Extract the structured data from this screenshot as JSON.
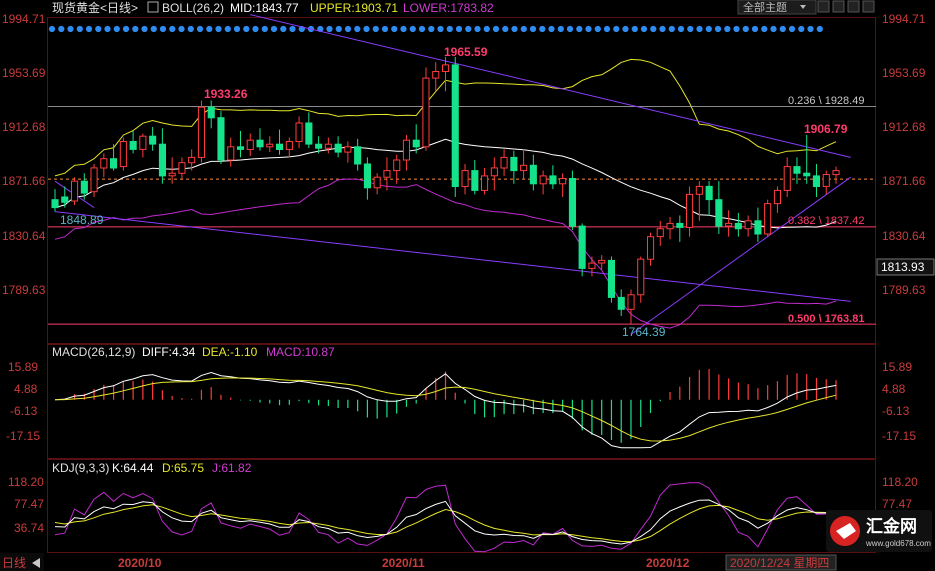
{
  "header": {
    "instrument": "现货黄金<日线>",
    "boll_label": "BOLL(26,2)",
    "mid_label": "MID:1843.77",
    "upper_label": "UPPER:1903.71",
    "lower_label": "LOWER:1783.82",
    "theme_button": "全部主题",
    "theme_icon": "chevron-down-icon",
    "toolbar_icons": [
      "minus-icon",
      "plus-icon",
      "grid-icon",
      "close-icon"
    ]
  },
  "price_panel": {
    "y_ticks": [
      "1994.71",
      "1953.69",
      "1912.68",
      "1871.66",
      "1830.64",
      "1789.63"
    ],
    "last_price": "1813.93",
    "annotations": {
      "high": "1965.59",
      "high2": "1933.26",
      "low": "1764.39",
      "start": "1848.89",
      "recent_high": "1906.79"
    },
    "fib_levels": [
      {
        "label": "0.236 \\ 1928.49",
        "value": 1928.49
      },
      {
        "label": "0.382 \\ 1837.42",
        "value": 1837.42
      },
      {
        "label": "0.500 \\ 1763.81",
        "value": 1763.81
      }
    ],
    "dashed_level": 1873.5
  },
  "macd_panel": {
    "title": "MACD(26,12,9)",
    "diff": "DIFF:4.34",
    "dea": "DEA:-1.10",
    "macd": "MACD:10.87",
    "y_ticks": [
      "15.89",
      "4.88",
      "-6.13",
      "-17.15"
    ]
  },
  "kdj_panel": {
    "title": "KDJ(9,3,3)",
    "k": "K:64.44",
    "d": "D:65.75",
    "j": "J:61.82",
    "y_ticks": [
      "118.20",
      "77.47",
      "36.74"
    ]
  },
  "x_axis": {
    "left_label": "日线",
    "ticks": [
      "2020/10",
      "2020/11",
      "2020/12"
    ],
    "cursor_date": "2020/12/24 星期四"
  },
  "watermark": {
    "brand": "汇金网",
    "url": "www.gold678.com"
  },
  "colors": {
    "up": "#ff3c3c",
    "down": "#14e38c",
    "upper_band": "#e6e62a",
    "mid_band": "#ffffff",
    "lower_band": "#c02ad0",
    "trendline": "#8a3cff",
    "fib_line": "#ff3c6e",
    "axis_text": "#c83c3c",
    "dea": "#e6e62a",
    "diff": "#ffffff",
    "kdj_k": "#ffffff",
    "kdj_d": "#e6e62a",
    "kdj_j": "#c02ad0"
  },
  "chart_data": {
    "type": "candlestick",
    "instrument": "现货黄金",
    "period": "日线",
    "y_range": [
      1750,
      2000
    ],
    "candles": [
      {
        "o": 1858,
        "h": 1866,
        "l": 1849,
        "c": 1852
      },
      {
        "o": 1860,
        "h": 1868,
        "l": 1852,
        "c": 1856
      },
      {
        "o": 1857,
        "h": 1875,
        "l": 1854,
        "c": 1872
      },
      {
        "o": 1872,
        "h": 1878,
        "l": 1858,
        "c": 1863
      },
      {
        "o": 1864,
        "h": 1885,
        "l": 1860,
        "c": 1882
      },
      {
        "o": 1882,
        "h": 1893,
        "l": 1875,
        "c": 1889
      },
      {
        "o": 1889,
        "h": 1900,
        "l": 1880,
        "c": 1882
      },
      {
        "o": 1883,
        "h": 1905,
        "l": 1880,
        "c": 1902
      },
      {
        "o": 1902,
        "h": 1910,
        "l": 1893,
        "c": 1896
      },
      {
        "o": 1896,
        "h": 1908,
        "l": 1890,
        "c": 1906
      },
      {
        "o": 1906,
        "h": 1913,
        "l": 1895,
        "c": 1900
      },
      {
        "o": 1900,
        "h": 1912,
        "l": 1870,
        "c": 1876
      },
      {
        "o": 1876,
        "h": 1890,
        "l": 1870,
        "c": 1878
      },
      {
        "o": 1878,
        "h": 1890,
        "l": 1873,
        "c": 1886
      },
      {
        "o": 1886,
        "h": 1896,
        "l": 1880,
        "c": 1890
      },
      {
        "o": 1890,
        "h": 1933,
        "l": 1886,
        "c": 1928
      },
      {
        "o": 1928,
        "h": 1933,
        "l": 1912,
        "c": 1920
      },
      {
        "o": 1920,
        "h": 1925,
        "l": 1885,
        "c": 1888
      },
      {
        "o": 1888,
        "h": 1905,
        "l": 1883,
        "c": 1898
      },
      {
        "o": 1898,
        "h": 1910,
        "l": 1890,
        "c": 1896
      },
      {
        "o": 1896,
        "h": 1908,
        "l": 1891,
        "c": 1903
      },
      {
        "o": 1903,
        "h": 1912,
        "l": 1895,
        "c": 1898
      },
      {
        "o": 1898,
        "h": 1906,
        "l": 1894,
        "c": 1900
      },
      {
        "o": 1900,
        "h": 1911,
        "l": 1892,
        "c": 1896
      },
      {
        "o": 1896,
        "h": 1905,
        "l": 1890,
        "c": 1902
      },
      {
        "o": 1902,
        "h": 1921,
        "l": 1897,
        "c": 1916
      },
      {
        "o": 1916,
        "h": 1924,
        "l": 1897,
        "c": 1900
      },
      {
        "o": 1900,
        "h": 1906,
        "l": 1893,
        "c": 1897
      },
      {
        "o": 1897,
        "h": 1905,
        "l": 1893,
        "c": 1900
      },
      {
        "o": 1900,
        "h": 1906,
        "l": 1890,
        "c": 1894
      },
      {
        "o": 1894,
        "h": 1902,
        "l": 1886,
        "c": 1898
      },
      {
        "o": 1898,
        "h": 1904,
        "l": 1880,
        "c": 1885
      },
      {
        "o": 1885,
        "h": 1890,
        "l": 1858,
        "c": 1867
      },
      {
        "o": 1867,
        "h": 1878,
        "l": 1862,
        "c": 1875
      },
      {
        "o": 1875,
        "h": 1890,
        "l": 1865,
        "c": 1880
      },
      {
        "o": 1880,
        "h": 1892,
        "l": 1870,
        "c": 1888
      },
      {
        "o": 1888,
        "h": 1907,
        "l": 1880,
        "c": 1903
      },
      {
        "o": 1903,
        "h": 1915,
        "l": 1893,
        "c": 1898
      },
      {
        "o": 1898,
        "h": 1958,
        "l": 1895,
        "c": 1950
      },
      {
        "o": 1950,
        "h": 1962,
        "l": 1940,
        "c": 1955
      },
      {
        "o": 1955,
        "h": 1966,
        "l": 1940,
        "c": 1960
      },
      {
        "o": 1960,
        "h": 1966,
        "l": 1860,
        "c": 1868
      },
      {
        "o": 1868,
        "h": 1885,
        "l": 1862,
        "c": 1880
      },
      {
        "o": 1880,
        "h": 1888,
        "l": 1862,
        "c": 1865
      },
      {
        "o": 1865,
        "h": 1882,
        "l": 1862,
        "c": 1876
      },
      {
        "o": 1876,
        "h": 1890,
        "l": 1865,
        "c": 1882
      },
      {
        "o": 1882,
        "h": 1896,
        "l": 1876,
        "c": 1890
      },
      {
        "o": 1890,
        "h": 1895,
        "l": 1870,
        "c": 1880
      },
      {
        "o": 1880,
        "h": 1896,
        "l": 1874,
        "c": 1884
      },
      {
        "o": 1884,
        "h": 1892,
        "l": 1865,
        "c": 1870
      },
      {
        "o": 1870,
        "h": 1880,
        "l": 1862,
        "c": 1876
      },
      {
        "o": 1876,
        "h": 1884,
        "l": 1866,
        "c": 1870
      },
      {
        "o": 1870,
        "h": 1878,
        "l": 1860,
        "c": 1874
      },
      {
        "o": 1874,
        "h": 1880,
        "l": 1835,
        "c": 1838
      },
      {
        "o": 1838,
        "h": 1840,
        "l": 1800,
        "c": 1806
      },
      {
        "o": 1806,
        "h": 1815,
        "l": 1800,
        "c": 1810
      },
      {
        "o": 1810,
        "h": 1816,
        "l": 1805,
        "c": 1812
      },
      {
        "o": 1812,
        "h": 1815,
        "l": 1780,
        "c": 1784
      },
      {
        "o": 1784,
        "h": 1790,
        "l": 1770,
        "c": 1775
      },
      {
        "o": 1775,
        "h": 1790,
        "l": 1764,
        "c": 1786
      },
      {
        "o": 1786,
        "h": 1815,
        "l": 1780,
        "c": 1813
      },
      {
        "o": 1813,
        "h": 1833,
        "l": 1808,
        "c": 1830
      },
      {
        "o": 1830,
        "h": 1842,
        "l": 1823,
        "c": 1836
      },
      {
        "o": 1836,
        "h": 1845,
        "l": 1828,
        "c": 1840
      },
      {
        "o": 1840,
        "h": 1846,
        "l": 1826,
        "c": 1837
      },
      {
        "o": 1837,
        "h": 1868,
        "l": 1830,
        "c": 1862
      },
      {
        "o": 1862,
        "h": 1872,
        "l": 1842,
        "c": 1868
      },
      {
        "o": 1868,
        "h": 1872,
        "l": 1846,
        "c": 1858
      },
      {
        "o": 1858,
        "h": 1872,
        "l": 1832,
        "c": 1838
      },
      {
        "o": 1838,
        "h": 1850,
        "l": 1830,
        "c": 1840
      },
      {
        "o": 1840,
        "h": 1848,
        "l": 1830,
        "c": 1836
      },
      {
        "o": 1836,
        "h": 1846,
        "l": 1830,
        "c": 1842
      },
      {
        "o": 1842,
        "h": 1852,
        "l": 1826,
        "c": 1832
      },
      {
        "o": 1832,
        "h": 1858,
        "l": 1830,
        "c": 1855
      },
      {
        "o": 1855,
        "h": 1868,
        "l": 1848,
        "c": 1865
      },
      {
        "o": 1865,
        "h": 1890,
        "l": 1860,
        "c": 1883
      },
      {
        "o": 1883,
        "h": 1890,
        "l": 1870,
        "c": 1878
      },
      {
        "o": 1878,
        "h": 1907,
        "l": 1870,
        "c": 1876
      },
      {
        "o": 1876,
        "h": 1885,
        "l": 1860,
        "c": 1868
      },
      {
        "o": 1868,
        "h": 1880,
        "l": 1862,
        "c": 1877
      },
      {
        "o": 1877,
        "h": 1883,
        "l": 1870,
        "c": 1880
      }
    ],
    "macd_hist_range": [
      -22,
      22
    ]
  }
}
